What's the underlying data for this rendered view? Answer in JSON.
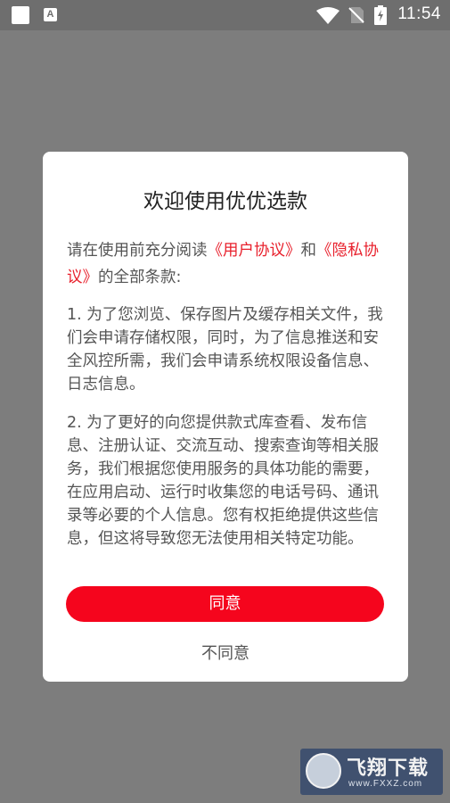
{
  "status_bar": {
    "time": "11:54",
    "icons": [
      "app-square-icon",
      "accessibility-a-icon",
      "wifi-icon",
      "no-sim-icon",
      "battery-charging-icon"
    ],
    "a_glyph": "A"
  },
  "dialog": {
    "title": "欢迎使用优优选款",
    "intro": {
      "prefix": "请在使用前充分阅读",
      "user_agreement": "《用户协议》",
      "and": "和",
      "privacy_policy": "《隐私协议》",
      "suffix": "的全部条款:"
    },
    "paragraphs": [
      "1. 为了您浏览、保存图片及缓存相关文件，我们会申请存储权限，同时，为了信息推送和安全风控所需，我们会申请系统权限设备信息、日志信息。",
      "2. 为了更好的向您提供款式库查看、发布信息、注册认证、交流互动、搜索查询等相关服务，我们根据您使用服务的具体功能的需要，在应用启动、运行时收集您的电话号码、通讯录等必要的个人信息。您有权拒绝提供这些信息，但这将导致您无法使用相关特定功能。"
    ],
    "agree_label": "同意",
    "disagree_label": "不同意"
  },
  "watermark": {
    "text": "飞翔下载",
    "url": "www.FXXZ.com"
  },
  "colors": {
    "accent": "#f5051d",
    "link": "#e8202c",
    "overlay": "#7d7d7d"
  }
}
